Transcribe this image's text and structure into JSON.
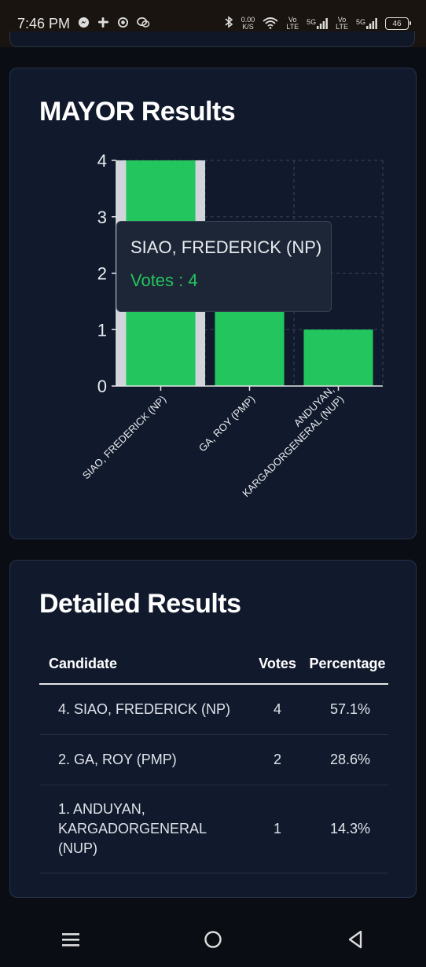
{
  "status_bar": {
    "time": "7:46 PM",
    "net_speed_value": "0.00",
    "net_speed_unit": "K/S",
    "sim1_label_top": "Vo",
    "sim1_label_bottom": "LTE",
    "sim1_network": "5G",
    "sim2_label_top": "Vo",
    "sim2_label_bottom": "LTE",
    "sim2_network": "5G",
    "battery": "46"
  },
  "mayor_card": {
    "title": "MAYOR Results"
  },
  "chart_data": {
    "type": "bar",
    "categories": [
      "SIAO, FREDERICK (NP)",
      "GA, ROY (PMP)",
      "ANDUYAN, KARGADORGENERAL (NUP)"
    ],
    "category_lines": [
      [
        "SIAO, FREDERICK (NP)"
      ],
      [
        "GA, ROY (PMP)"
      ],
      [
        "ANDUYAN,",
        "KARGADORGENERAL (NUP)"
      ]
    ],
    "values": [
      4,
      2,
      1
    ],
    "ylim": [
      0,
      4
    ],
    "yticks": [
      "0",
      "1",
      "2",
      "3",
      "4"
    ],
    "title": "",
    "xlabel": "",
    "ylabel": "",
    "grid": true,
    "bar_color": "#22c55e",
    "highlight_color": "#d1d5db"
  },
  "tooltip": {
    "name": "SIAO, FREDERICK (NP)",
    "votes": "Votes : 4"
  },
  "detail_card": {
    "title": "Detailed Results",
    "columns": [
      "Candidate",
      "Votes",
      "Percentage"
    ],
    "rows": [
      {
        "candidate": "4. SIAO, FREDERICK (NP)",
        "votes": "4",
        "percentage": "57.1%"
      },
      {
        "candidate": "2. GA, ROY (PMP)",
        "votes": "2",
        "percentage": "28.6%"
      },
      {
        "candidate_line1": "1. ANDUYAN,",
        "candidate_line2": "KARGADORGENERAL",
        "candidate_line3": "(NUP)",
        "votes": "1",
        "percentage": "14.3%"
      }
    ]
  },
  "colors": {
    "accent_green": "#22c55e",
    "card_bg": "#111a2c",
    "page_bg": "#0b0d14"
  },
  "nav_bar": {
    "icons": [
      "menu-icon",
      "home-icon",
      "back-icon"
    ]
  }
}
